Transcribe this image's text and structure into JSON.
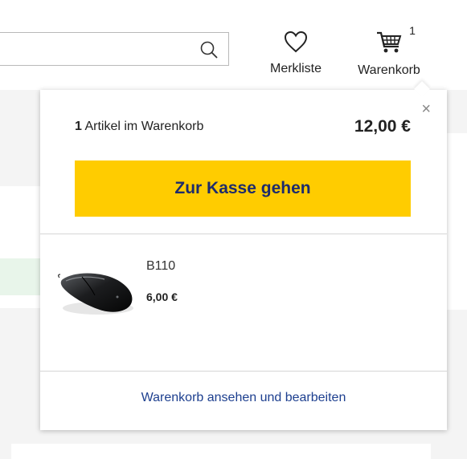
{
  "header": {
    "search": {
      "value": ""
    },
    "wishlist": {
      "label": "Merkliste",
      "icon": "heart-icon"
    },
    "cart": {
      "label": "Warenkorb",
      "count": "1",
      "icon": "cart-icon"
    }
  },
  "minicart": {
    "summary_count": "1",
    "summary_text": "Artikel im Warenkorb",
    "total": "12,00 €",
    "close_icon": "×",
    "checkout_label": "Zur Kasse gehen",
    "items": [
      {
        "name": "B110",
        "price": "6,00 €",
        "image": "computer-mouse"
      }
    ],
    "view_cart_label": "Warenkorb ansehen und bearbeiten"
  },
  "colors": {
    "checkout_bg": "#ffcc00",
    "checkout_text": "#1d2b6c",
    "link": "#1d3f8f"
  }
}
